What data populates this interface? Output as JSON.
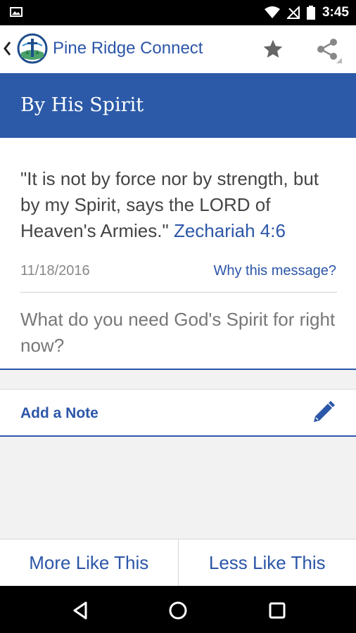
{
  "status_bar": {
    "time": "3:45",
    "icons": [
      "image-notification-icon",
      "wifi-icon",
      "no-signal-icon",
      "battery-icon"
    ]
  },
  "app_bar": {
    "title": "Pine Ridge Connect",
    "icons": [
      "back-icon",
      "church-logo",
      "star-icon",
      "share-icon"
    ]
  },
  "banner": {
    "heading": "By His Spirit"
  },
  "message": {
    "verse_text": "\"It is not by force nor by strength, but by my Spirit, says the LORD of Heaven's Armies.\"",
    "verse_reference": "Zechariah 4:6",
    "date": "11/18/2016",
    "why_link": "Why this message?",
    "question": "What do you need God's Spirit for right now?"
  },
  "note": {
    "label": "Add a Note",
    "icon": "pencil-icon"
  },
  "actions": {
    "more_label": "More Like This",
    "less_label": "Less Like This"
  },
  "nav_bar": {
    "icons": [
      "back-triangle-icon",
      "home-circle-icon",
      "recents-square-icon"
    ]
  },
  "colors": {
    "accent": "#2c56a8",
    "banner": "#2c5aa8"
  }
}
